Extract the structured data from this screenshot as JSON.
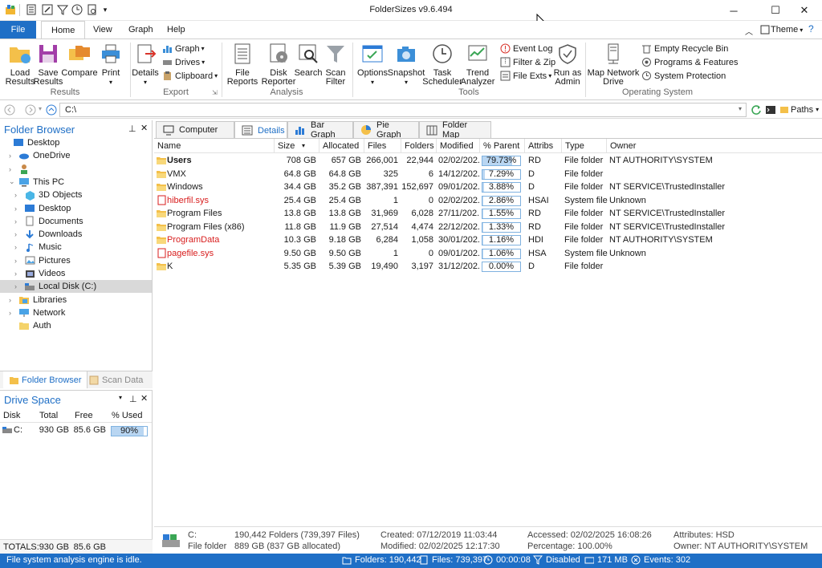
{
  "window": {
    "title": "FolderSizes v9.6.494"
  },
  "ribbon_tabs": [
    "File",
    "Home",
    "View",
    "Graph",
    "Help"
  ],
  "theme_label": "Theme",
  "ribbon": {
    "load_results": "Load\nResults",
    "save_results": "Save\nResults",
    "compare": "Compare",
    "print": "Print",
    "results_group": "Results",
    "details": "Details",
    "graph": "Graph",
    "drives": "Drives",
    "clipboard": "Clipboard",
    "export_group": "Export",
    "file_reports": "File\nReports",
    "disk_reporter": "Disk\nReporter",
    "search": "Search",
    "scan_filter": "Scan\nFilter",
    "analysis_group": "Analysis",
    "options": "Options",
    "snapshot": "Snapshot",
    "task_scheduler": "Task\nScheduler",
    "trend_analyzer": "Trend\nAnalyzer",
    "event_log": "Event Log",
    "filter_zip": "Filter & Zip",
    "file_exts": "File Exts",
    "run_as_admin": "Run as\nAdmin",
    "tools_group": "Tools",
    "map_network_drive": "Map Network\nDrive",
    "empty_recycle_bin": "Empty Recycle Bin",
    "programs_features": "Programs & Features",
    "system_protection": "System Protection",
    "os_group": "Operating System"
  },
  "address": {
    "path": "C:\\",
    "paths_label": "Paths"
  },
  "folder_browser": {
    "title": "Folder Browser",
    "tree": [
      {
        "label": "Desktop",
        "indent": 0,
        "arrow": ""
      },
      {
        "label": "OneDrive",
        "indent": 1,
        "arrow": "›"
      },
      {
        "label": "",
        "indent": 1,
        "arrow": "›"
      },
      {
        "label": "This PC",
        "indent": 1,
        "arrow": "⌄"
      },
      {
        "label": "3D Objects",
        "indent": 2,
        "arrow": "›"
      },
      {
        "label": "Desktop",
        "indent": 2,
        "arrow": "›"
      },
      {
        "label": "Documents",
        "indent": 2,
        "arrow": "›"
      },
      {
        "label": "Downloads",
        "indent": 2,
        "arrow": "›"
      },
      {
        "label": "Music",
        "indent": 2,
        "arrow": "›"
      },
      {
        "label": "Pictures",
        "indent": 2,
        "arrow": "›"
      },
      {
        "label": "Videos",
        "indent": 2,
        "arrow": "›"
      },
      {
        "label": "Local Disk (C:)",
        "indent": 2,
        "arrow": "›"
      },
      {
        "label": "Libraries",
        "indent": 1,
        "arrow": "›"
      },
      {
        "label": "Network",
        "indent": 1,
        "arrow": "›"
      },
      {
        "label": "Auth",
        "indent": 1,
        "arrow": ""
      }
    ],
    "tab_folder_browser": "Folder Browser",
    "tab_scan_data": "Scan Data"
  },
  "drive_space": {
    "title": "Drive Space",
    "headers": [
      "Disk",
      "Total",
      "Free",
      "% Used"
    ],
    "rows": [
      {
        "disk": "C:",
        "total": "930 GB",
        "free": "85.6 GB",
        "used": "90%",
        "used_frac": 0.9
      }
    ],
    "totals_label": "TOTALS:",
    "totals_total": "930 GB",
    "totals_free": "85.6 GB"
  },
  "view_tabs": [
    "Computer",
    "Details",
    "Bar Graph",
    "Pie Graph",
    "Folder Map"
  ],
  "grid": {
    "headers": [
      "Name",
      "Size",
      "Allocated",
      "Files",
      "Folders",
      "Modified",
      "% Parent",
      "Attribs",
      "Type",
      "Owner"
    ],
    "rows": [
      {
        "name": "Users",
        "size": "708 GB",
        "alloc": "657 GB",
        "files": "266,001",
        "folders": "22,944",
        "modified": "02/02/202...",
        "pct": "79.73%",
        "pct_frac": 0.7973,
        "attribs": "RD",
        "type": "File folder",
        "owner": "NT AUTHORITY\\SYSTEM",
        "style": "bold"
      },
      {
        "name": "VMX",
        "size": "64.8 GB",
        "alloc": "64.8 GB",
        "files": "325",
        "folders": "6",
        "modified": "14/12/202...",
        "pct": "7.29%",
        "pct_frac": 0.0729,
        "attribs": "D",
        "type": "File folder",
        "owner": "",
        "style": "normal"
      },
      {
        "name": "Windows",
        "size": "34.4 GB",
        "alloc": "35.2 GB",
        "files": "387,391",
        "folders": "152,697",
        "modified": "09/01/202...",
        "pct": "3.88%",
        "pct_frac": 0.0388,
        "attribs": "D",
        "type": "File folder",
        "owner": "NT SERVICE\\TrustedInstaller",
        "style": "normal"
      },
      {
        "name": "hiberfil.sys",
        "size": "25.4 GB",
        "alloc": "25.4 GB",
        "files": "1",
        "folders": "0",
        "modified": "02/02/202...",
        "pct": "2.86%",
        "pct_frac": 0.0286,
        "attribs": "HSAI",
        "type": "System file",
        "owner": "Unknown",
        "style": "red"
      },
      {
        "name": "Program Files",
        "size": "13.8 GB",
        "alloc": "13.8 GB",
        "files": "31,969",
        "folders": "6,028",
        "modified": "27/11/202...",
        "pct": "1.55%",
        "pct_frac": 0.0155,
        "attribs": "RD",
        "type": "File folder",
        "owner": "NT SERVICE\\TrustedInstaller",
        "style": "normal"
      },
      {
        "name": "Program Files (x86)",
        "size": "11.8 GB",
        "alloc": "11.9 GB",
        "files": "27,514",
        "folders": "4,474",
        "modified": "22/12/202...",
        "pct": "1.33%",
        "pct_frac": 0.0133,
        "attribs": "RD",
        "type": "File folder",
        "owner": "NT SERVICE\\TrustedInstaller",
        "style": "normal"
      },
      {
        "name": "ProgramData",
        "size": "10.3 GB",
        "alloc": "9.18 GB",
        "files": "6,284",
        "folders": "1,058",
        "modified": "30/01/202...",
        "pct": "1.16%",
        "pct_frac": 0.0116,
        "attribs": "HDI",
        "type": "File folder",
        "owner": "NT AUTHORITY\\SYSTEM",
        "style": "red"
      },
      {
        "name": "pagefile.sys",
        "size": "9.50 GB",
        "alloc": "9.50 GB",
        "files": "1",
        "folders": "0",
        "modified": "09/01/202...",
        "pct": "1.06%",
        "pct_frac": 0.0106,
        "attribs": "HSA",
        "type": "System file",
        "owner": "Unknown",
        "style": "red"
      },
      {
        "name": "K",
        "size": "5.35 GB",
        "alloc": "5.39 GB",
        "files": "19,490",
        "folders": "3,197",
        "modified": "31/12/202...",
        "pct": "0.00%",
        "pct_frac": 0.0,
        "attribs": "D",
        "type": "File folder",
        "owner": "",
        "style": "normal"
      }
    ]
  },
  "info": {
    "drive": "C:",
    "kind": "File folder",
    "folders": "190,442 Folders (739,397 Files)",
    "size": "889 GB (837 GB allocated)",
    "created": "Created: 07/12/2019 11:03:44",
    "modified": "Modified: 02/02/2025 12:17:30",
    "accessed": "Accessed: 02/02/2025 16:08:26",
    "percentage": "Percentage: 100.00%",
    "attributes": "Attributes: HSD",
    "owner": "Owner: NT AUTHORITY\\SYSTEM"
  },
  "status": {
    "message": "File system analysis engine is idle.",
    "folders": "Folders: 190,442",
    "files": "Files: 739,397",
    "time": "00:00:08",
    "filter": "Disabled",
    "memory": "171 MB",
    "events": "Events: 302"
  },
  "colors": {
    "accent": "#1f6fc6",
    "red_item": "#d81e1e",
    "bar_fill": "#b9d6f2",
    "bar_border": "#7fb2e0"
  }
}
